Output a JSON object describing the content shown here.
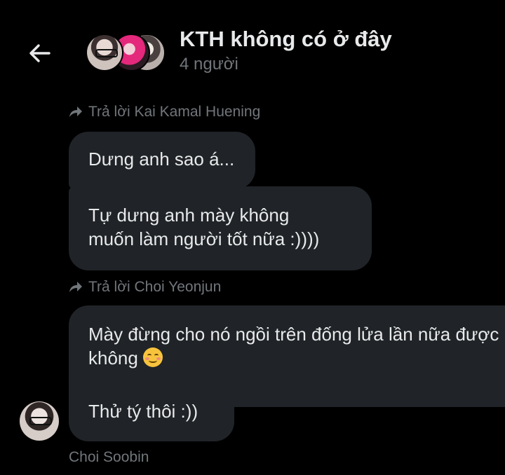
{
  "header": {
    "back_icon": "arrow-left-icon",
    "title": "KTH không có ở đây",
    "subtitle": "4 người"
  },
  "messages": {
    "reply1_label": "Trả lời Kai Kamal Huening",
    "bubble1": "Dưng anh sao á...",
    "bubble2_line1": "Tự dưng anh mày không",
    "bubble2_line2": "muốn làm người tốt nữa :))))",
    "reply2_label": "Trả lời Choi Yeonjun",
    "bubble3_line1": "Mày đừng cho nó ngồi trên đống lửa lần nữa được",
    "bubble3_line2": "không",
    "bubble4": "Thử tý thôi :))",
    "sender_name": "Choi Soobin"
  },
  "colors": {
    "background": "#000000",
    "bubble": "#202327",
    "text": "#e7e9ea",
    "muted": "#71767b"
  }
}
